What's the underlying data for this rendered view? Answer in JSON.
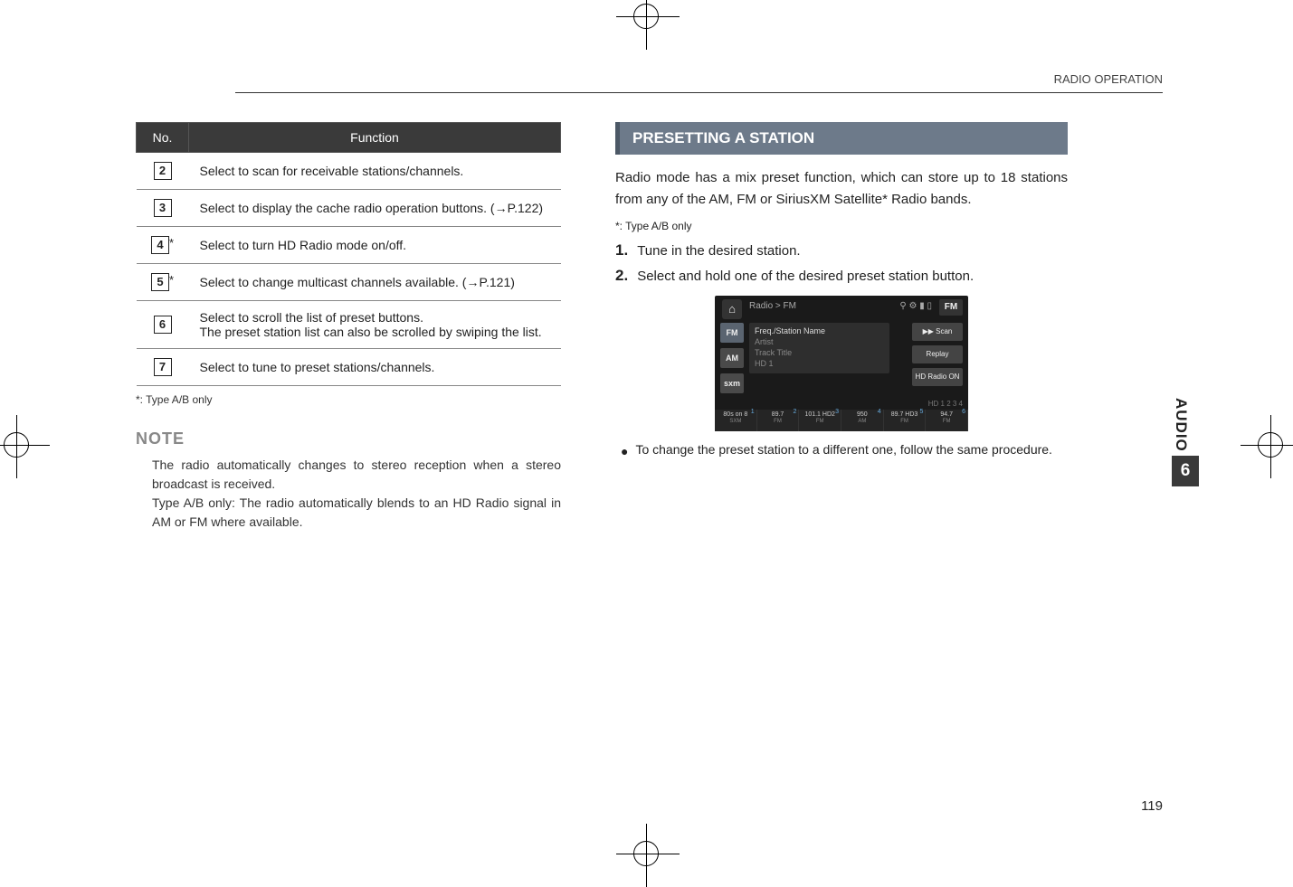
{
  "header": {
    "breadcrumb": "RADIO OPERATION"
  },
  "funcTable": {
    "head_no": "No.",
    "head_fn": "Function",
    "rows": [
      {
        "num": "2",
        "star": false,
        "text": "Select to scan for receivable stations/channels."
      },
      {
        "num": "3",
        "star": false,
        "text": "Select to display the cache radio operation buttons. (→P.122)"
      },
      {
        "num": "4",
        "star": true,
        "text": "Select to turn HD Radio mode on/off."
      },
      {
        "num": "5",
        "star": true,
        "text": "Select to change multicast channels available. (→P.121)"
      },
      {
        "num": "6",
        "star": false,
        "text": "Select to scroll the list of preset buttons.\nThe preset station list can also be scrolled by swiping the list."
      },
      {
        "num": "7",
        "star": false,
        "text": "Select to tune to preset stations/channels."
      }
    ]
  },
  "footnote_left": "*:   Type A/B only",
  "note": {
    "head": "NOTE",
    "l1": "The radio automatically changes to stereo reception when a stereo broadcast is received.",
    "l2": "Type A/B only: The radio automatically blends to an HD Radio signal in AM or FM where available."
  },
  "right": {
    "section_title": "PRESETTING A STATION",
    "intro": "Radio mode has a mix preset function, which can store up to 18 stations from any of the AM, FM or SiriusXM Satellite* Radio bands.",
    "footnote": "*:   Type A/B only",
    "steps": [
      {
        "n": "1.",
        "t": "Tune in the desired station."
      },
      {
        "n": "2.",
        "t": "Select and hold one of the desired preset station button."
      }
    ],
    "screenshot": {
      "breadcrumb": "Radio  >  FM",
      "status_icons": "⚲ ⚙ ▮ ▯",
      "source_badge": "FM",
      "tabs": [
        "FM",
        "AM",
        "sxm"
      ],
      "main_title": "Freq./Station Name",
      "main_artist": "Artist",
      "main_track": "Track Title",
      "main_hd": "HD 1",
      "rbtns": [
        "▶▶ Scan",
        "Replay",
        "HD Radio ON"
      ],
      "hd_indicator": "HD 1 2 3 4",
      "presets": [
        {
          "top": "80s on 8",
          "band": "SXM",
          "n": "1"
        },
        {
          "top": "89.7",
          "band": "FM",
          "n": "2"
        },
        {
          "top": "101.1 HD2",
          "band": "FM",
          "n": "3"
        },
        {
          "top": "950",
          "band": "AM",
          "n": "4"
        },
        {
          "top": "89.7 HD3",
          "band": "FM",
          "n": "5"
        },
        {
          "top": "94.7",
          "band": "FM",
          "n": "6"
        }
      ]
    },
    "bullet": "To change the preset station to a different one, follow the same procedure."
  },
  "side": {
    "label": "AUDIO",
    "chapter": "6"
  },
  "page_number": "119"
}
